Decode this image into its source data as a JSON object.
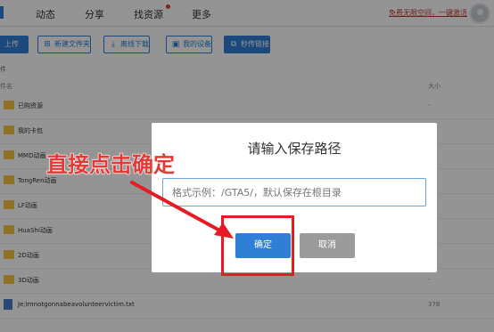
{
  "nav": {
    "items": [
      "动态",
      "分享",
      "找资源",
      "更多"
    ],
    "promo": "免费无限空间，一键激活"
  },
  "toolbar": {
    "upload": "上传",
    "new_folder": "新建文件夹",
    "offline_download": "离线下载",
    "my_devices": "我的设备",
    "quick_link": "秒传链接"
  },
  "breadcrumb": "件",
  "columns": {
    "name": "件名",
    "size": "大小"
  },
  "files": [
    {
      "name": "已购资源",
      "size": "-",
      "type": "folder"
    },
    {
      "name": "我的卡包",
      "size": "",
      "type": "folder"
    },
    {
      "name": "MMD动画",
      "size": "",
      "type": "folder"
    },
    {
      "name": "TongRen动画",
      "size": "",
      "type": "folder"
    },
    {
      "name": "LF动画",
      "size": "",
      "type": "folder"
    },
    {
      "name": "HuaShi动画",
      "size": "",
      "type": "folder"
    },
    {
      "name": "2D动画",
      "size": "",
      "type": "folder"
    },
    {
      "name": "3D动画",
      "size": "-",
      "type": "folder"
    },
    {
      "name": "Je;Imnotgonnabeavolunteervictim.txt",
      "size": "37B",
      "type": "file"
    }
  ],
  "dialog": {
    "title": "请输入保存路径",
    "placeholder": "格式示例：/GTA5/，默认保存在根目录",
    "confirm": "确定",
    "cancel": "取消"
  },
  "annotation": "直接点击确定"
}
